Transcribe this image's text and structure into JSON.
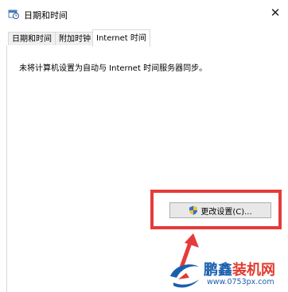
{
  "window": {
    "title": "日期和时间",
    "close_glyph": "✕"
  },
  "tabs": [
    {
      "label": "日期和时间",
      "active": false
    },
    {
      "label": "附加时钟",
      "active": false
    },
    {
      "label": "Internet 时间",
      "active": true
    }
  ],
  "panel": {
    "message": "未将计算机设置为自动与 Internet 时间服务器同步。",
    "change_settings_button": "更改设置(C)..."
  },
  "watermark": {
    "title_part1": "鹏鑫",
    "title_part2": "装机网",
    "url": "www.0753px.com"
  },
  "colors": {
    "highlight_border": "#e63b3b",
    "arrow": "#e63b3b",
    "watermark_blue": "#1a5fae",
    "watermark_red": "#e23b2e"
  },
  "icons": {
    "title": "calendar-clock-icon",
    "button": "uac-shield-icon"
  }
}
